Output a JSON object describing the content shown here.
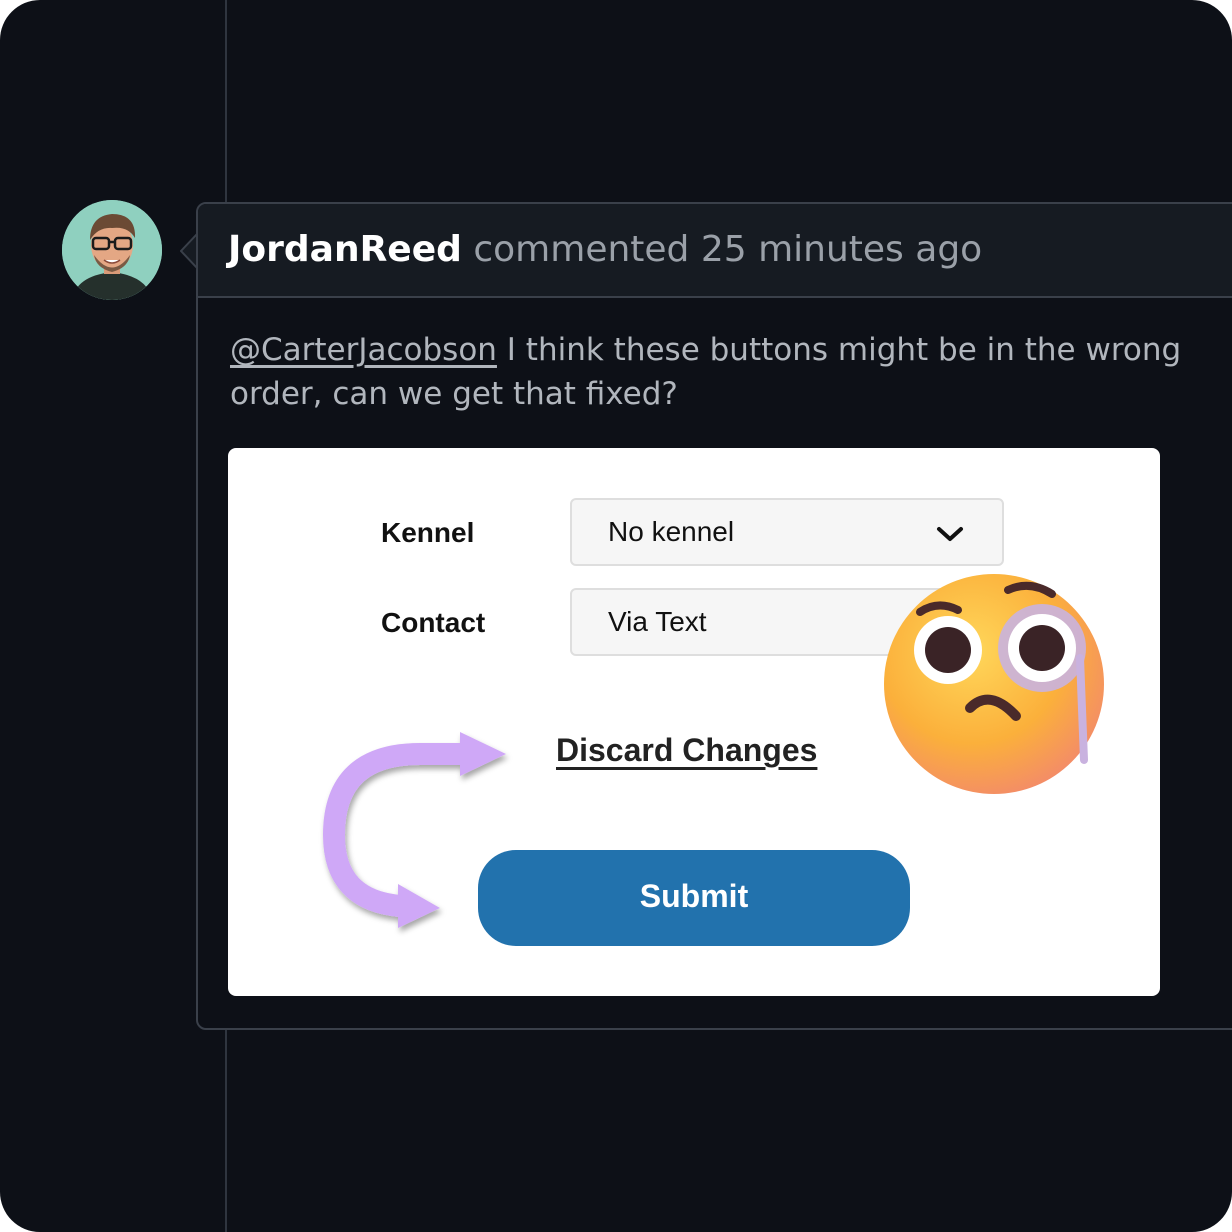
{
  "comment": {
    "author": "JordanReed",
    "action": "commented 25 minutes ago",
    "mention": "@CarterJacobson",
    "message": " I think these buttons might be in the wrong order, can we get that fixed?"
  },
  "form": {
    "kennel_label": "Kennel",
    "kennel_value": "No kennel",
    "contact_label": "Contact",
    "contact_value": "Via Text",
    "discard_label": "Discard Changes",
    "submit_label": "Submit"
  },
  "colors": {
    "background": "#0d1017",
    "header": "#161b22",
    "submit": "#2272ad",
    "arrow": "#cfa8f7"
  },
  "icons": {
    "avatar": "user-avatar",
    "dropdown": "chevron-down-icon",
    "arrow": "curved-arrow-icon",
    "emoji": "face-with-monocle-emoji"
  }
}
